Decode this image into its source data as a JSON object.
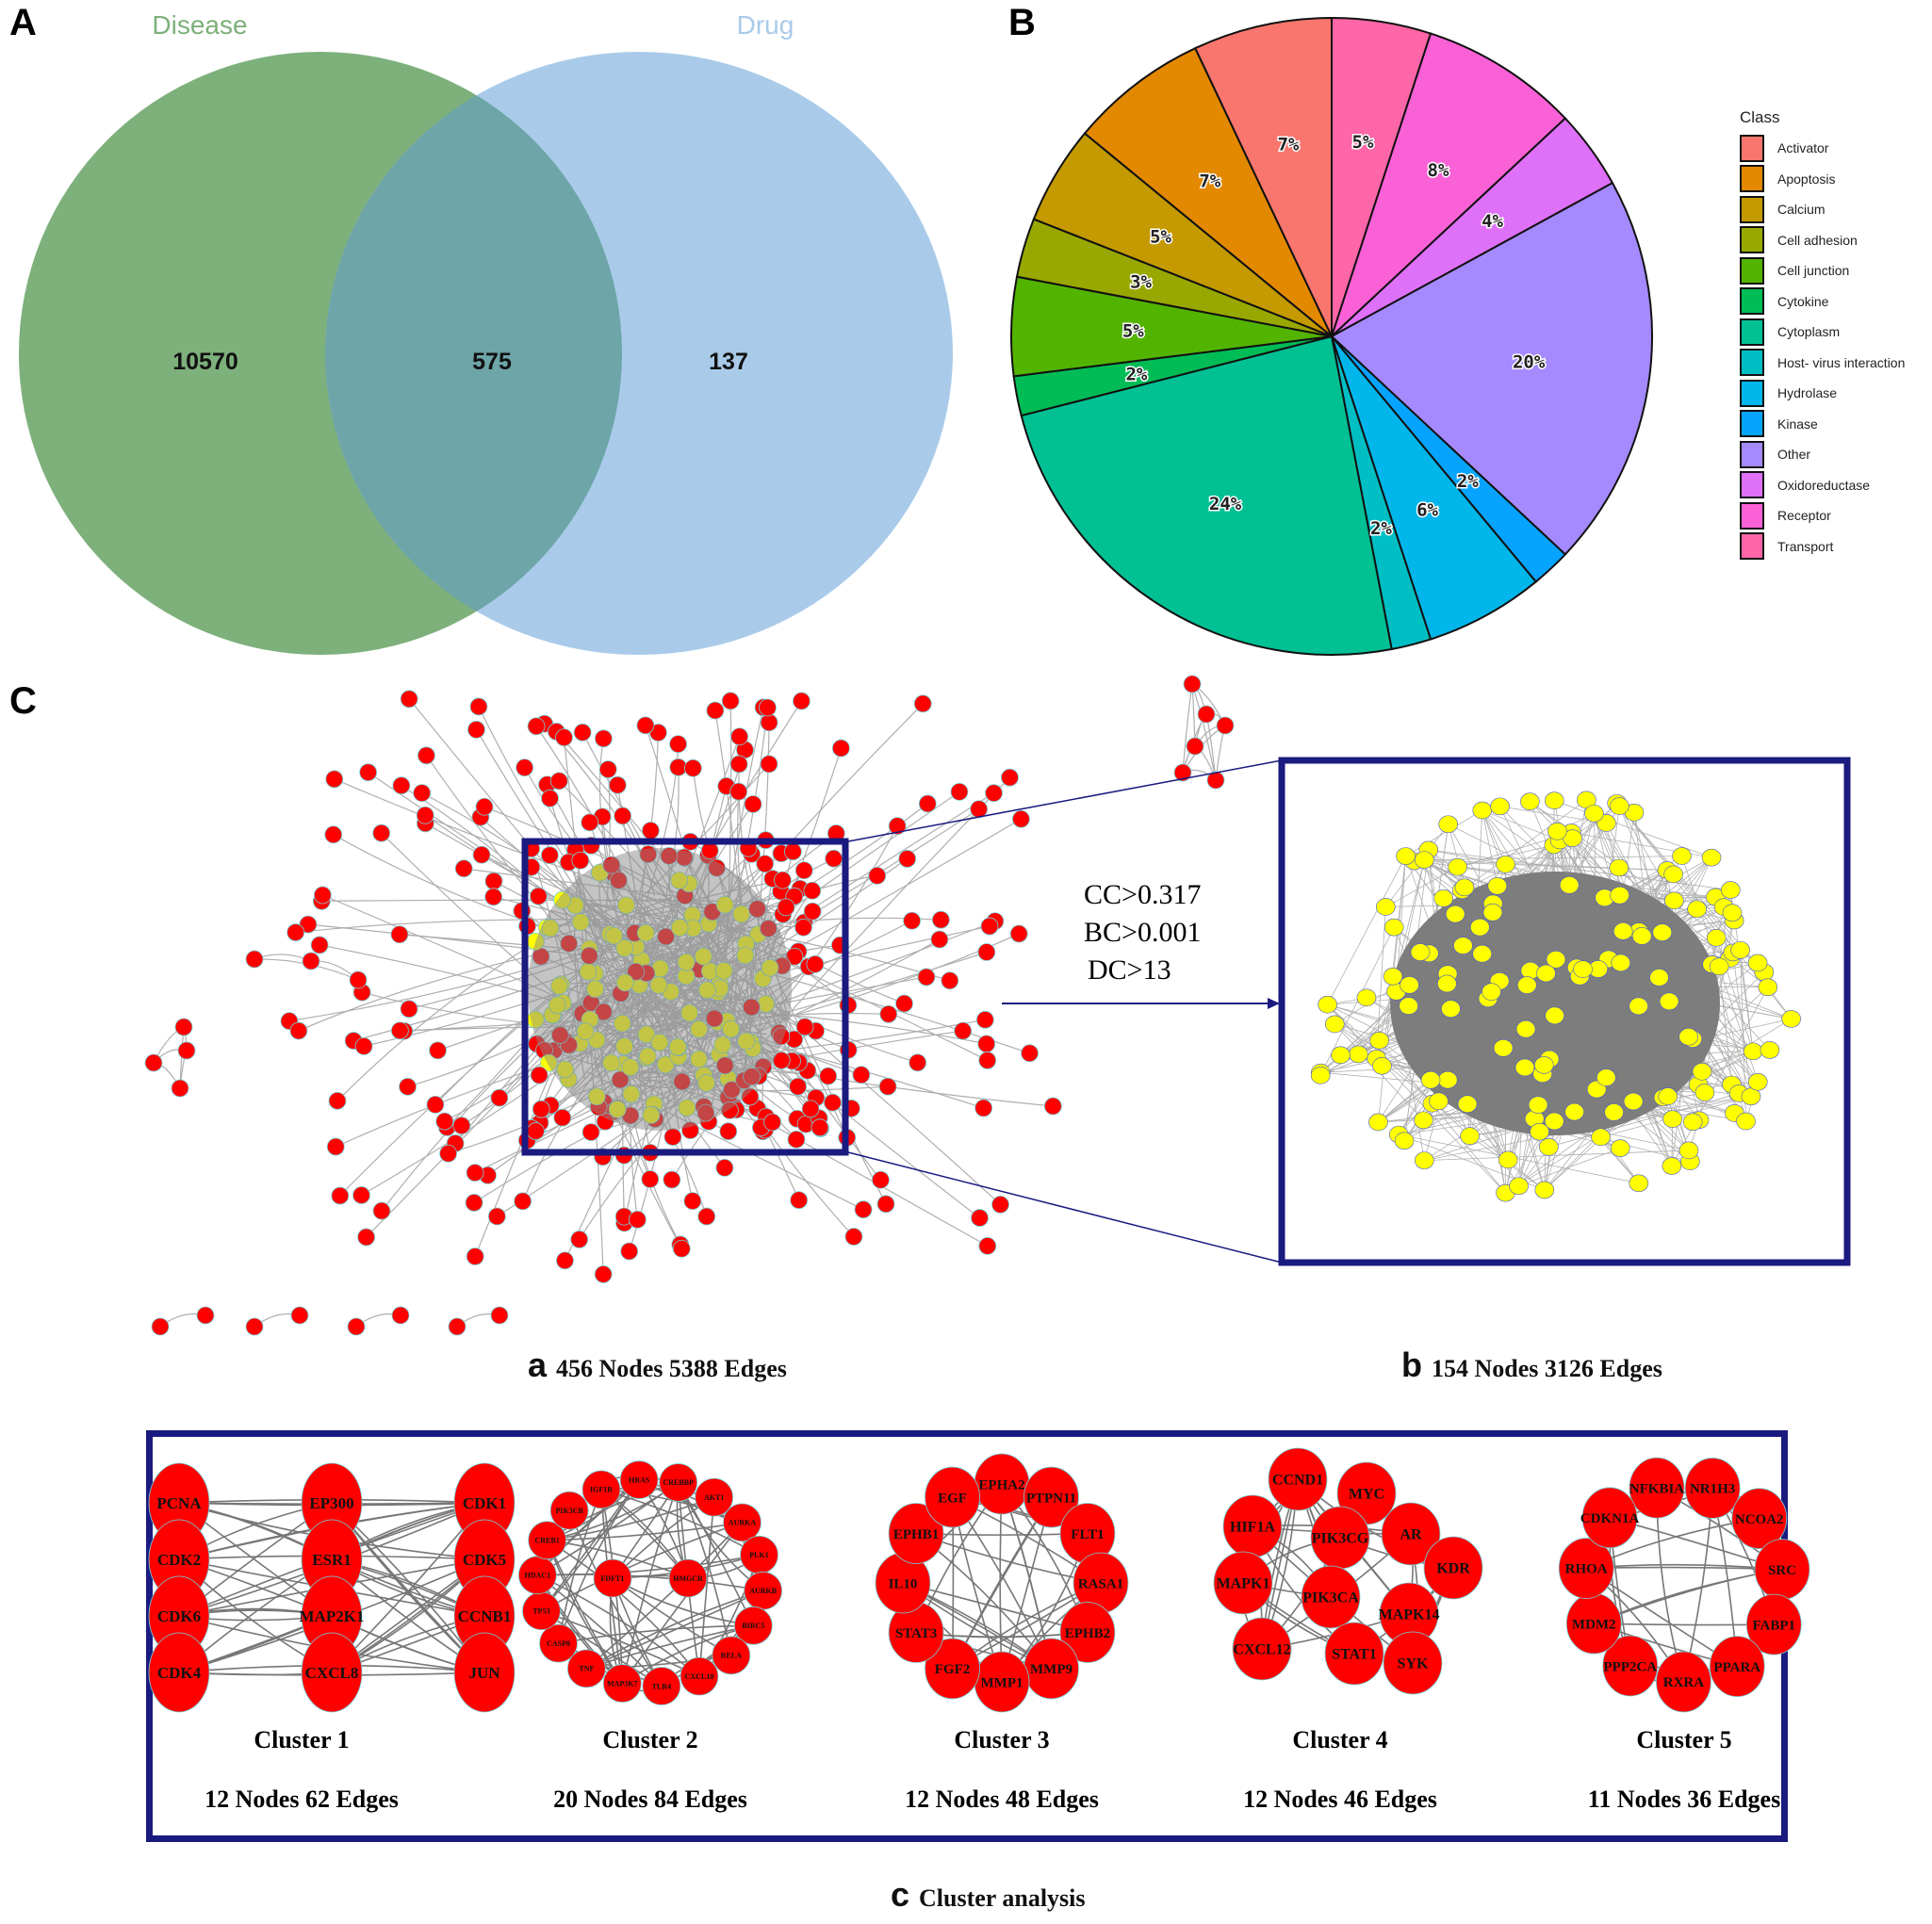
{
  "panels": {
    "A": {
      "letter": "A",
      "venn": {
        "sets": [
          {
            "name": "Disease",
            "color": "#7db07b",
            "label_color": "#7db07b"
          },
          {
            "name": "Drug",
            "color": "#a9cbe9",
            "label_color": "#a9cbe9"
          }
        ],
        "overlap_color": "#6da5a8",
        "values": {
          "disease_only": "10570",
          "intersection": "575",
          "drug_only": "137"
        }
      }
    },
    "B": {
      "letter": "B",
      "legend_title": "Class"
    },
    "C": {
      "letter": "C",
      "filters": [
        "CC>0.317",
        "BC>0.001",
        "DC>13"
      ],
      "network_a": {
        "tag": "a",
        "caption": "456 Nodes 5388 Edges",
        "node_color": "#ff0000",
        "hub_color": "#ffff00"
      },
      "network_b": {
        "tag": "b",
        "caption": "154 Nodes 3126 Edges",
        "node_color": "#ffff00"
      },
      "cluster_analysis": {
        "tag": "c",
        "caption": "Cluster analysis",
        "frame_color": "#1a1a80",
        "clusters": [
          {
            "title": "Cluster 1",
            "stats": "12 Nodes 62 Edges",
            "layout": "grid",
            "nodes": [
              "PCNA",
              "EP300",
              "CDK1",
              "CDK2",
              "ESR1",
              "CDK5",
              "CDK6",
              "MAP2K1",
              "CCNB1",
              "CDK4",
              "CXCL8",
              "JUN"
            ]
          },
          {
            "title": "Cluster 2",
            "stats": "20 Nodes 84 Edges",
            "layout": "ring-center",
            "nodes": [
              "CREBBP",
              "AKT1",
              "AURKA",
              "PLK1",
              "AURKB",
              "BIRC5",
              "RELA",
              "CXCL10",
              "TLR4",
              "MAP3K7",
              "TNF",
              "CASP8",
              "TP53",
              "HDAC1",
              "CREB1",
              "PIK3CB",
              "IGF1R",
              "HRAS",
              "FDFT1",
              "HMGCR"
            ]
          },
          {
            "title": "Cluster 3",
            "stats": "12 Nodes 48 Edges",
            "layout": "ring",
            "nodes": [
              "EPHA2",
              "PTPN11",
              "FLT1",
              "RASA1",
              "EPHB2",
              "MMP9",
              "MMP1",
              "FGF2",
              "STAT3",
              "IL10",
              "EPHB1",
              "EGF"
            ]
          },
          {
            "title": "Cluster 4",
            "stats": "12 Nodes 46 Edges",
            "layout": "free",
            "nodes": [
              "CCND1",
              "MYC",
              "HIF1A",
              "PIK3CG",
              "AR",
              "KDR",
              "MAPK1",
              "PIK3CA",
              "MAPK14",
              "CXCL12",
              "STAT1",
              "SYK"
            ]
          },
          {
            "title": "Cluster 5",
            "stats": "11 Nodes 36 Edges",
            "layout": "ring",
            "nodes": [
              "NFKBIA",
              "NR1H3",
              "NCOA2",
              "SRC",
              "FABP1",
              "PPARA",
              "RXRA",
              "PPP2CA",
              "MDM2",
              "RHOA",
              "CDKN1A"
            ]
          }
        ]
      }
    }
  },
  "chart_data": {
    "type": "pie",
    "title": "",
    "legend_title": "Class",
    "legend_position": "right",
    "start": "top",
    "direction": "clockwise",
    "categories": [
      "Activator",
      "Apoptosis",
      "Calcium",
      "Cell adhesion",
      "Cell junction",
      "Cytokine",
      "Cytoplasm",
      "Host- virus interaction",
      "Hydrolase",
      "Kinase",
      "Other",
      "Oxidoreductase",
      "Receptor",
      "Transport"
    ],
    "colors": [
      "#f8766d",
      "#e38900",
      "#c49a00",
      "#99a800",
      "#53b400",
      "#00bc56",
      "#00c094",
      "#00bfc4",
      "#00b6eb",
      "#06a4ff",
      "#a58aff",
      "#df70f8",
      "#fb61d7",
      "#ff66a8"
    ],
    "values": [
      7,
      7,
      5,
      3,
      5,
      2,
      24,
      2,
      6,
      2,
      20,
      4,
      8,
      5
    ],
    "labels": [
      "7%",
      "7%",
      "5%",
      "3%",
      "5%",
      "2%",
      "24%",
      "2%",
      "6%",
      "2%",
      "20%",
      "4%",
      "8%",
      "5%"
    ],
    "slice_order_clockwise_from_top": [
      "Transport",
      "Receptor",
      "Oxidoreductase",
      "Other",
      "Kinase",
      "Hydrolase",
      "Host- virus interaction",
      "Cytoplasm",
      "Cytokine",
      "Cell junction",
      "Cell adhesion",
      "Calcium",
      "Apoptosis",
      "Activator"
    ]
  }
}
